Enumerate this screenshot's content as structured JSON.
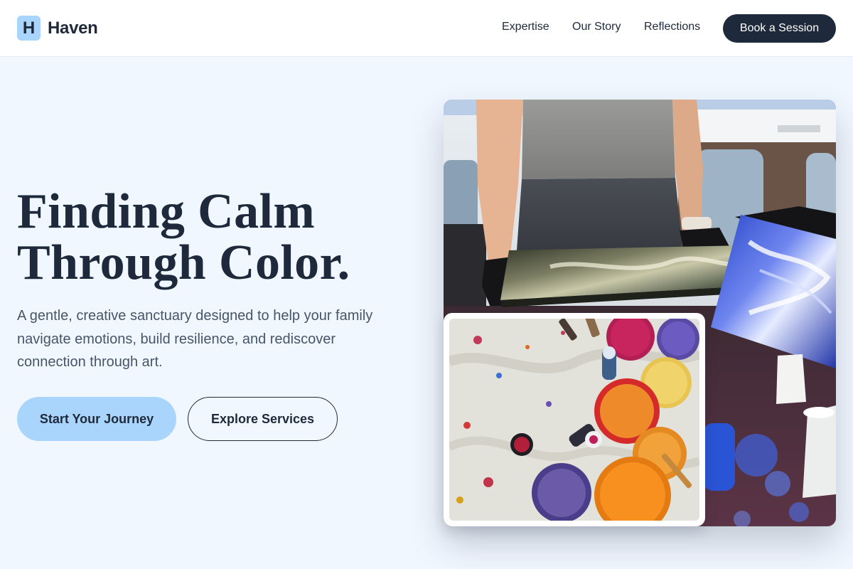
{
  "header": {
    "logo_letter": "H",
    "brand_name": "Haven",
    "nav": [
      {
        "label": "Expertise"
      },
      {
        "label": "Our Story"
      },
      {
        "label": "Reflections"
      }
    ],
    "cta_label": "Book a Session"
  },
  "hero": {
    "title_line1": "Finding Calm",
    "title_line2": "Through Color.",
    "subtitle": "A gentle, creative sanctuary designed to help your family navigate emotions, build resilience, and rediscover connection through art.",
    "primary_button": "Start Your Journey",
    "secondary_button": "Explore Services"
  },
  "images": {
    "main_photo_icon": "fluid-art-painting-photo",
    "inset_photo_icon": "paint-cups-photo"
  },
  "colors": {
    "page_background": "#f0f7ff",
    "brand_accent": "#a9d4fb",
    "dark_navy": "#1e293b",
    "body_text": "#475569"
  }
}
